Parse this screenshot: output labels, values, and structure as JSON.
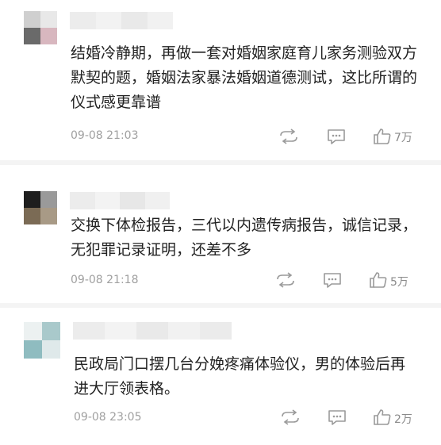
{
  "comments": [
    {
      "text": "结婚冷静期，再做一套对婚姻家庭育儿家务测验双方默契的题，婚姻法家暴法婚姻道德测试，这比所谓的仪式感更靠谱",
      "time": "09-08 21:03",
      "likes": "7万"
    },
    {
      "text": "交换下体检报告，三代以内遗传病报告，诚信记录，无犯罪记录证明，还差不多",
      "time": "09-08 21:18",
      "likes": "5万"
    },
    {
      "text": "民政局门口摆几台分娩疼痛体验仪，男的体验后再进大厅领表格。",
      "time": "09-08 23:05",
      "likes": "2万"
    }
  ],
  "icons": {
    "share": "share-icon",
    "comment": "comment-icon",
    "like": "thumbs-up-icon"
  },
  "colors": {
    "text": "#222222",
    "meta": "#a0a0a0",
    "icon": "#9a9a9a",
    "separator": "#f4f4f4"
  }
}
